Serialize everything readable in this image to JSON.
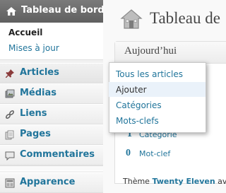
{
  "sidebar": {
    "dashboard_label": "Tableau de bord",
    "dashboard_sub": {
      "current": "Accueil",
      "updates": "Mises à jour"
    },
    "items": [
      {
        "label": "Articles",
        "icon": "pushpin-icon"
      },
      {
        "label": "Médias",
        "icon": "media-icon"
      },
      {
        "label": "Liens",
        "icon": "link-icon"
      },
      {
        "label": "Pages",
        "icon": "page-icon"
      },
      {
        "label": "Commentaires",
        "icon": "comment-icon"
      },
      {
        "label": "Apparence",
        "icon": "appearance-icon"
      }
    ]
  },
  "flyout": {
    "items": [
      {
        "label": "Tous les articles"
      },
      {
        "label": "Ajouter"
      },
      {
        "label": "Catégories"
      },
      {
        "label": "Mots-clefs"
      }
    ]
  },
  "main": {
    "title": "Tableau de",
    "widget_title": "Aujourd’hui",
    "stats": [
      {
        "num": "1",
        "label": "Catégorie"
      },
      {
        "num": "0",
        "label": "Mot-clef"
      }
    ],
    "theme_prefix": "Thème",
    "theme_name": "Twenty Eleven",
    "theme_suffix": "av"
  },
  "colors": {
    "link": "#21759b",
    "header": "#686868"
  }
}
